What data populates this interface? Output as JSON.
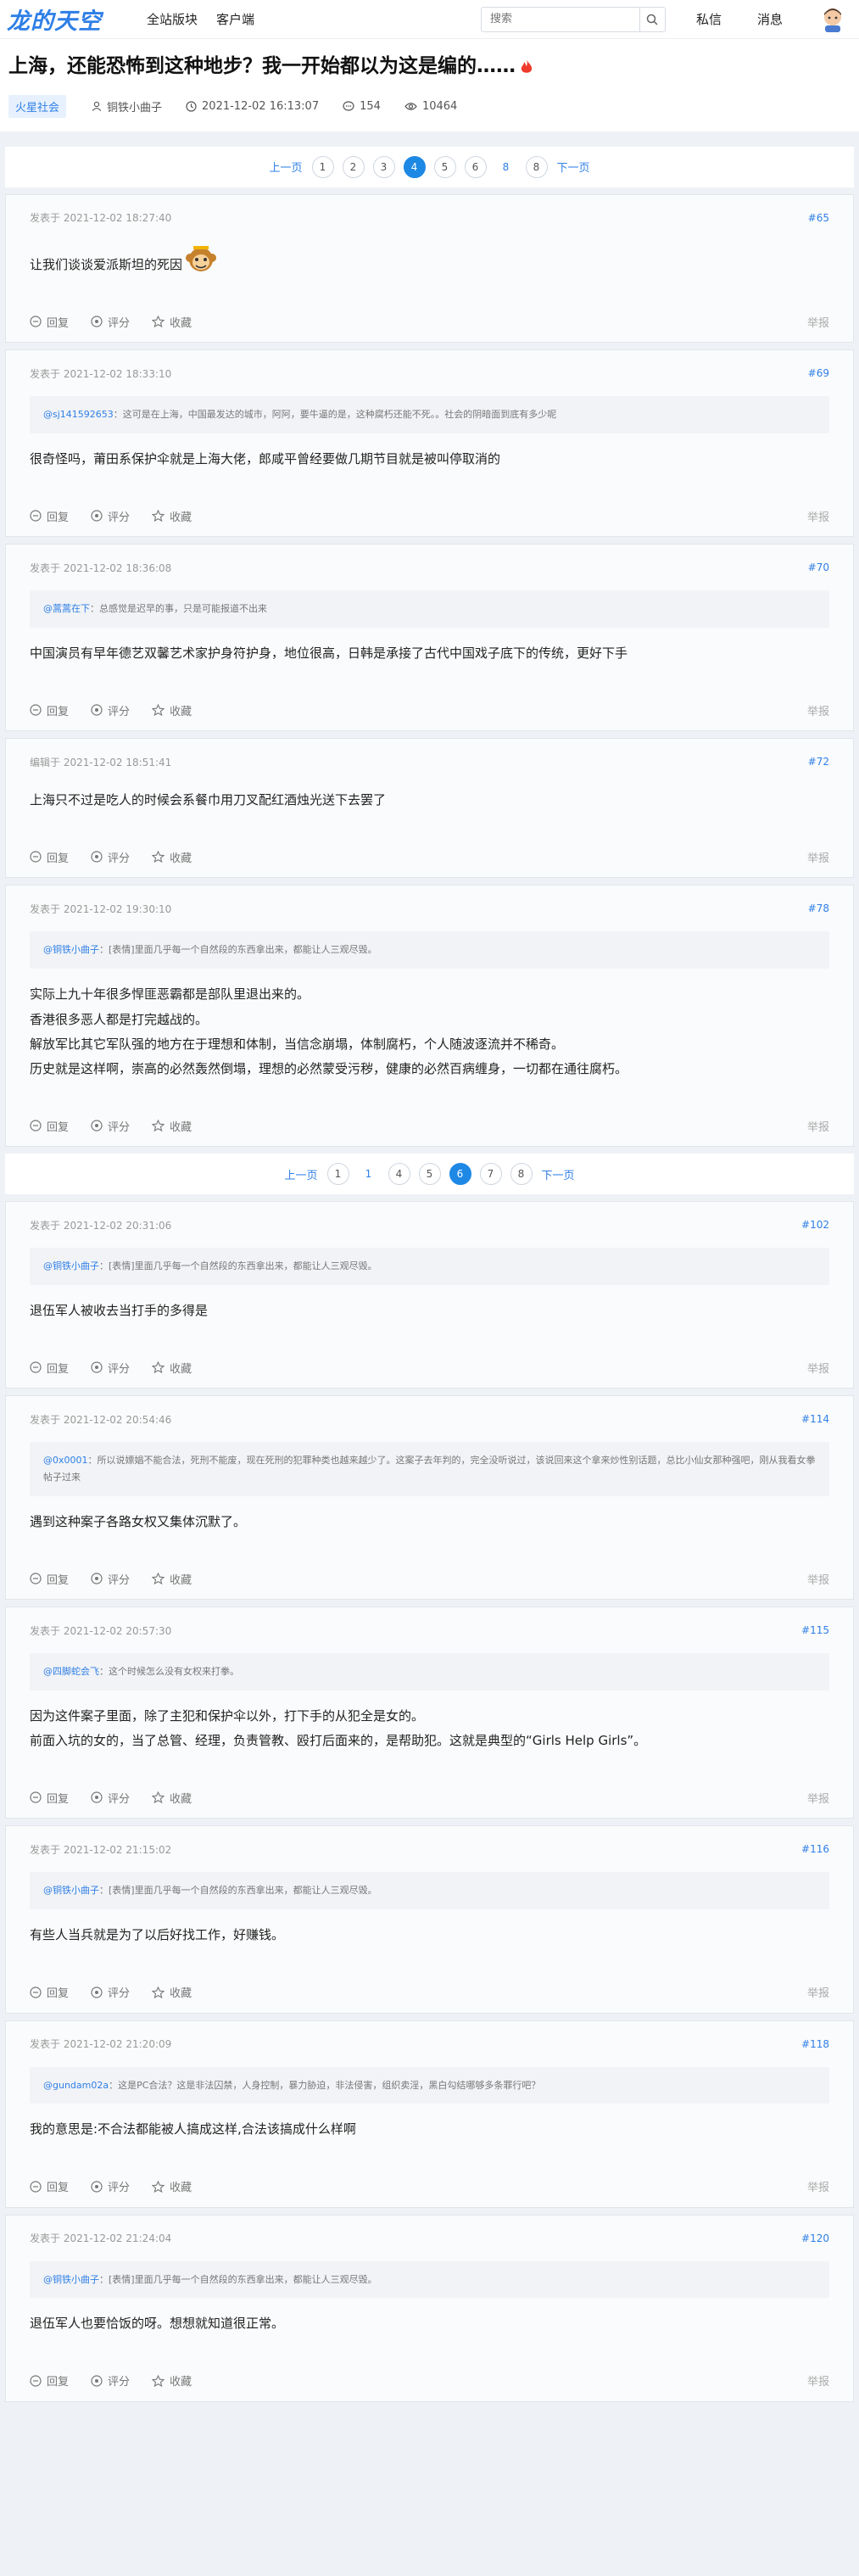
{
  "topbar": {
    "logo": "龙的天空",
    "nav": [
      "全站版块",
      "客户端"
    ],
    "search_placeholder": "搜索",
    "actions": [
      "私信",
      "消息"
    ]
  },
  "header": {
    "title": "上海，还能恐怖到这种地步？我一开始都以为这是编的……",
    "tag": "火星社会",
    "author": "铜铁小曲子",
    "time": "2021-12-02 16:13:07",
    "comments": "154",
    "views": "10464"
  },
  "pager1": {
    "prev": "上一页",
    "pages": [
      "1",
      "2",
      "3",
      "4",
      "5",
      "6",
      "8",
      "8"
    ],
    "next": "下一页"
  },
  "pager2": {
    "prev": "上一页",
    "pages": [
      "1",
      "1",
      "4",
      "5",
      "6",
      "7",
      "8"
    ],
    "next": "下一页"
  },
  "labels": {
    "reply": "回复",
    "rate": "评分",
    "fav": "收藏",
    "report": "举报"
  },
  "replies": [
    {
      "when": "发表于 2021-12-02 18:27:40",
      "floor": "#65",
      "lines": [
        "让我们谈谈爱派斯坦的死因"
      ]
    },
    {
      "when": "发表于 2021-12-02 18:33:10",
      "floor": "#69",
      "quote_user": "@sj141592653",
      "quote_text": "：这可是在上海，中国最发达的城市，阿阿，要牛逼的是，这种腐朽还能不死。。社会的阴暗面到底有多少呢",
      "lines": [
        "很奇怪吗，莆田系保护伞就是上海大佬，郎咸平曾经要做几期节目就是被叫停取消的"
      ]
    },
    {
      "when": "发表于 2021-12-02 18:36:08",
      "floor": "#70",
      "quote_user": "@蒿蒿在下",
      "quote_text": "：总感觉是迟早的事，只是可能报道不出来",
      "lines": [
        "中国演员有早年德艺双馨艺术家护身符护身，地位很高，日韩是承接了古代中国戏子底下的传统，更好下手"
      ]
    },
    {
      "when": "编辑于 2021-12-02 18:51:41",
      "floor": "#72",
      "lines": [
        "上海只不过是吃人的时候会系餐巾用刀叉配红酒烛光送下去罢了"
      ]
    },
    {
      "when": "发表于 2021-12-02 19:30:10",
      "floor": "#78",
      "quote_user": "@铜铁小曲子",
      "quote_text": "：[表情]里面几乎每一个自然段的东西拿出来，都能让人三观尽毁。",
      "lines": [
        "实际上九十年很多悍匪恶霸都是部队里退出来的。",
        "香港很多恶人都是打完越战的。",
        "解放军比其它军队强的地方在于理想和体制，当信念崩塌，体制腐朽，个人随波逐流并不稀奇。",
        "历史就是这样啊，崇高的必然轰然倒塌，理想的必然蒙受污秽，健康的必然百病缠身，一切都在通往腐朽。"
      ]
    },
    {
      "when": "发表于 2021-12-02 20:31:06",
      "floor": "#102",
      "quote_user": "@铜铁小曲子",
      "quote_text": "：[表情]里面几乎每一个自然段的东西拿出来，都能让人三观尽毁。",
      "lines": [
        "退伍军人被收去当打手的多得是"
      ]
    },
    {
      "when": "发表于 2021-12-02 20:54:46",
      "floor": "#114",
      "quote_user": "@0x0001",
      "quote_text": "：所以说嫖娼不能合法，死刑不能废，现在死刑的犯罪种类也越来越少了。这案子去年判的，完全没听说过，该说回来这个拿来炒性别话题，总比小仙女那种强吧，刚从我看女拳帖子过来",
      "lines": [
        "遇到这种案子各路女权又集体沉默了。"
      ]
    },
    {
      "when": "发表于 2021-12-02 20:57:30",
      "floor": "#115",
      "quote_user": "@四脚蛇会飞",
      "quote_text": "：这个时候怎么没有女权来打拳。",
      "lines": [
        "因为这件案子里面，除了主犯和保护伞以外，打下手的从犯全是女的。",
        "前面入坑的女的，当了总管、经理，负责管教、殴打后面来的，是帮助犯。这就是典型的“Girls Help Girls”。"
      ]
    },
    {
      "when": "发表于 2021-12-02 21:15:02",
      "floor": "#116",
      "quote_user": "@铜铁小曲子",
      "quote_text": "：[表情]里面几乎每一个自然段的东西拿出来，都能让人三观尽毁。",
      "lines": [
        "有些人当兵就是为了以后好找工作，好赚钱。"
      ]
    },
    {
      "when": "发表于 2021-12-02 21:20:09",
      "floor": "#118",
      "quote_user": "@gundam02a",
      "quote_text": "：这是PC合法？这是非法囚禁，人身控制，暴力胁迫，非法侵害，组织卖淫，黑白勾结哪够多条罪行吧？",
      "lines": [
        "我的意思是:不合法都能被人搞成这样,合法该搞成什么样啊"
      ]
    },
    {
      "when": "发表于 2021-12-02 21:24:04",
      "floor": "#120",
      "quote_user": "@铜铁小曲子",
      "quote_text": "：[表情]里面几乎每一个自然段的东西拿出来，都能让人三观尽毁。",
      "lines": [
        "退伍军人也要恰饭的呀。想想就知道很正常。"
      ]
    }
  ]
}
